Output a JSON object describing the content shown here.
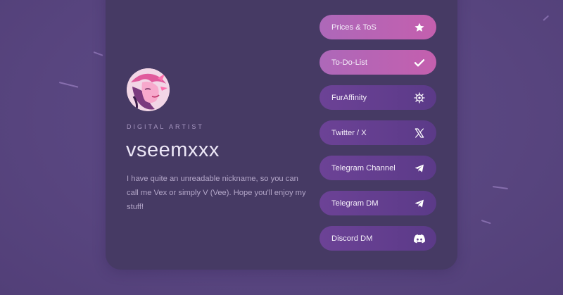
{
  "profile": {
    "role": "DIGITAL ARTIST",
    "name": "vseemxxx",
    "bio": "I have quite an unreadable nickname, so you can call me Vex or simply V (Vee). Hope you'll enjoy my stuff!",
    "avatar_icon": "character-avatar"
  },
  "links": [
    {
      "label": "Prices & ToS",
      "icon": "star-icon",
      "style": "highlight"
    },
    {
      "label": "To-Do-List",
      "icon": "check-icon",
      "style": "highlight"
    },
    {
      "label": "FurAffinity",
      "icon": "furaffinity-icon",
      "style": "standard"
    },
    {
      "label": "Twitter / X",
      "icon": "x-icon",
      "style": "standard"
    },
    {
      "label": "Telegram Channel",
      "icon": "telegram-icon",
      "style": "standard"
    },
    {
      "label": "Telegram DM",
      "icon": "telegram-icon",
      "style": "standard"
    },
    {
      "label": "Discord DM",
      "icon": "discord-icon",
      "style": "standard"
    }
  ],
  "colors": {
    "background": "#58457f",
    "card": "#463a64",
    "button_highlight": "#c45fae",
    "button_standard": "#5b3a88",
    "name_text": "#ece6f6",
    "bio_text": "#b3a6c8"
  }
}
